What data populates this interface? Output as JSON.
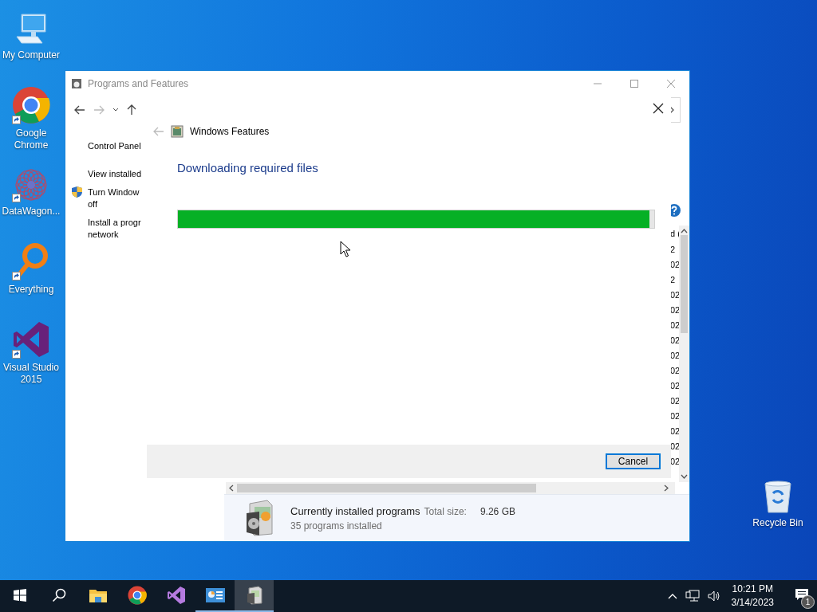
{
  "desktop_icons": [
    {
      "label": "My Computer",
      "kind": "computer",
      "shortcut": false
    },
    {
      "label": "Google Chrome",
      "kind": "chrome",
      "shortcut": true
    },
    {
      "label": "DataWagon...",
      "kind": "datawagon",
      "shortcut": true
    },
    {
      "label": "Everything",
      "kind": "everything",
      "shortcut": true
    },
    {
      "label": "Visual Studio 2015",
      "kind": "visualstudio",
      "shortcut": true
    }
  ],
  "recycle_bin": {
    "label": "Recycle Bin"
  },
  "window": {
    "title": "Programs and Features",
    "left_pane": [
      {
        "lines": [
          "Control Panel"
        ],
        "kind": "home"
      },
      {
        "lines": [
          "View installed"
        ],
        "kind": "link"
      },
      {
        "lines": [
          "Turn Window",
          "off"
        ],
        "kind": "shield"
      },
      {
        "lines": [
          "Install a progr",
          "network"
        ],
        "kind": "link"
      }
    ],
    "list": {
      "column_3_header": "d (",
      "column_3_fragments": [
        "2",
        "02",
        "2",
        "02",
        "02",
        "02",
        "02",
        "02",
        "02",
        "02",
        "02",
        "02",
        "02",
        "02",
        "02"
      ]
    },
    "details": {
      "title": "Currently installed programs",
      "size_label": "Total size:",
      "size_value": "9.26 GB",
      "count": "35 programs installed"
    }
  },
  "dialog": {
    "title": "Windows Features",
    "heading": "Downloading required files",
    "progress": {
      "level": 0.99
    },
    "buttons": [
      {
        "label": "Cancel",
        "default": true
      }
    ]
  },
  "taskbar": {
    "items": [
      {
        "kind": "start",
        "running": false,
        "selected": false
      },
      {
        "kind": "search",
        "running": false,
        "selected": false
      },
      {
        "kind": "folder",
        "running": false,
        "selected": false
      },
      {
        "kind": "chrome",
        "running": false,
        "selected": false
      },
      {
        "kind": "visualstudio",
        "running": false,
        "selected": false
      },
      {
        "kind": "controlpanel",
        "running": true,
        "selected": false
      },
      {
        "kind": "programs",
        "running": true,
        "selected": true
      }
    ],
    "time": "10:21 PM",
    "date": "3/14/2023",
    "notifications": "1"
  }
}
